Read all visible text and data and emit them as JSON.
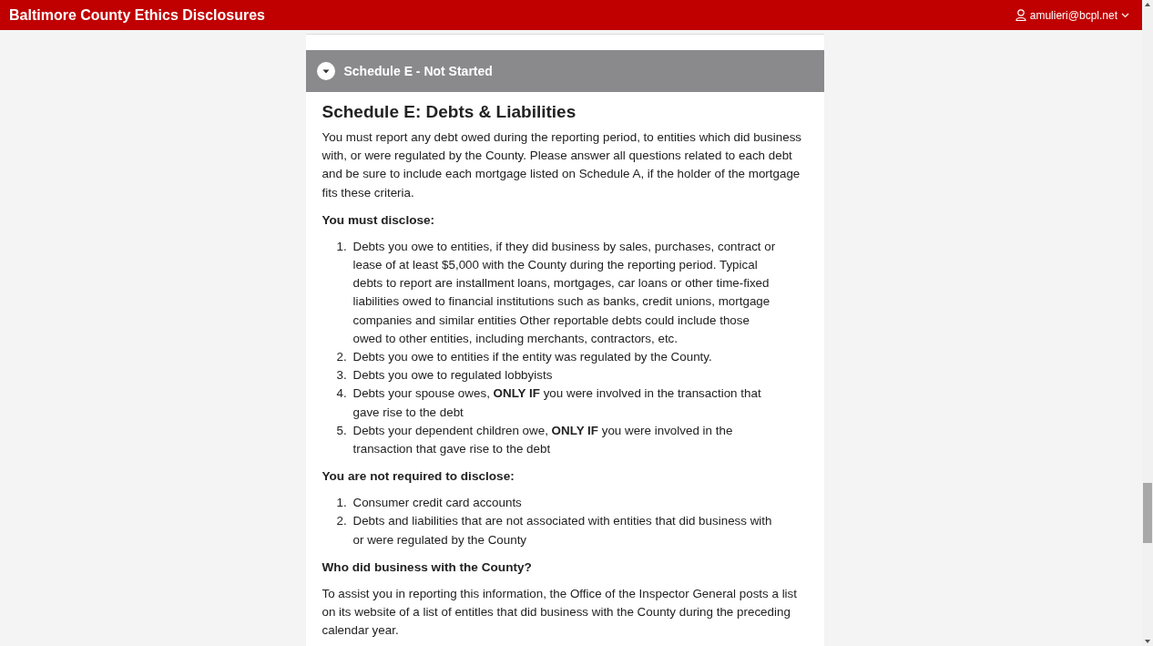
{
  "app_bar": {
    "title": "Baltimore County Ethics Disclosures",
    "user": "amulieri@bcpl.net"
  },
  "schedule": {
    "header": "Schedule E - Not Started",
    "expanded": true,
    "heading": "Schedule E: Debts & Liabilities",
    "intro": "You must report any debt owed during the reporting period, to entities which did business with, or were regulated by the County. Please answer all questions related to each debt and be sure to include each mortgage listed on Schedule A, if the holder of the mortgage fits these criteria.",
    "sections": [
      {
        "heading": "You must disclose:",
        "items": [
          {
            "number": "1.",
            "text": "Debts you owe to entities, if they did business by sales, purchases, contract or lease of at least $5,000 with the County during the reporting period. Typical debts to report are installment loans, mortgages, car loans or other time-fixed liabilities owed to financial institutions such as banks, credit unions, mortgage companies and similar entities Other reportable debts could include those owed to other entities, including merchants, contractors, etc."
          },
          {
            "number": "2.",
            "text": "Debts you owe to entities if the entity was regulated by the County."
          },
          {
            "number": "3.",
            "text": "Debts you owe to regulated lobbyists"
          },
          {
            "number": "4.",
            "text": "Debts your spouse owes, **ONLY IF** you were involved in the transaction that gave rise to the debt"
          },
          {
            "number": "5.",
            "text": "Debts your dependent children owe, **ONLY IF** you were involved in the transaction that gave rise to the debt"
          }
        ]
      },
      {
        "heading": "You are not required to disclose:",
        "items": [
          {
            "number": "1.",
            "text": "Consumer credit card accounts"
          },
          {
            "number": "2.",
            "text": "Debts and liabilities that are not associated with entities that did business with or were regulated by the County"
          }
        ]
      },
      {
        "heading": "Who did business with the County?",
        "paragraph": "To assist you in reporting this information, the Office of the Inspector General posts a list on its website of a list of entitles that did business with the County during the preceding calendar year."
      }
    ]
  }
}
